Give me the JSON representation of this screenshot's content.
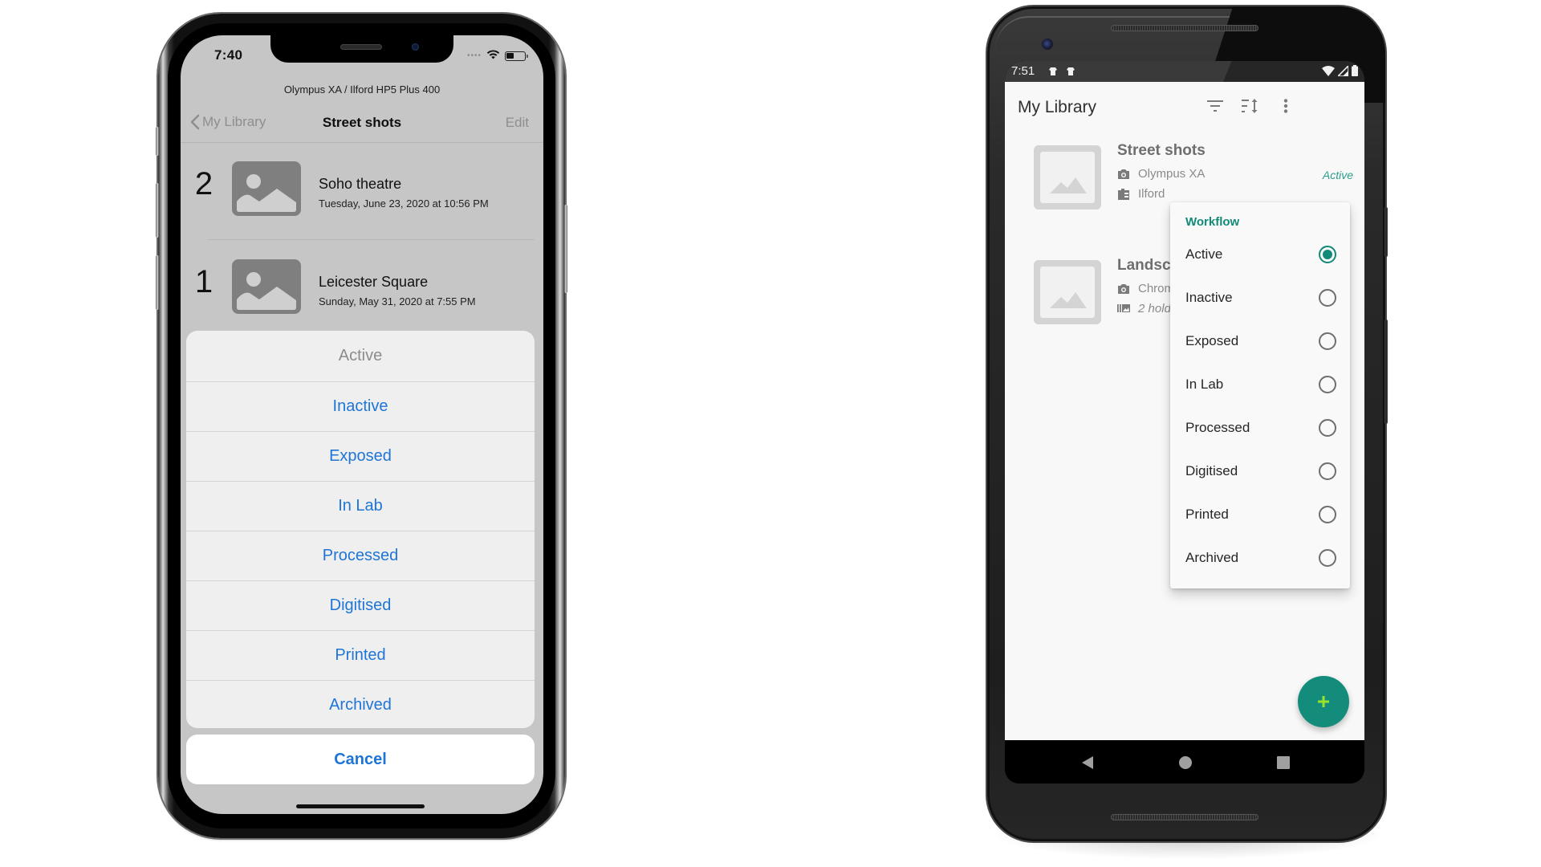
{
  "ios": {
    "status_time": "7:40",
    "subtitle": "Olympus XA / Ilford HP5 Plus 400",
    "nav": {
      "back_label": "My Library",
      "title": "Street shots",
      "edit_label": "Edit"
    },
    "rows": [
      {
        "number": "2",
        "title": "Soho theatre",
        "date": "Tuesday, June 23, 2020 at 10:56 PM"
      },
      {
        "number": "1",
        "title": "Leicester Square",
        "date": "Sunday, May 31, 2020 at 7:55 PM"
      }
    ],
    "action_sheet": {
      "current": "Active",
      "items": [
        "Active",
        "Inactive",
        "Exposed",
        "In Lab",
        "Processed",
        "Digitised",
        "Printed",
        "Archived"
      ],
      "cancel_label": "Cancel"
    }
  },
  "android": {
    "status_time": "7:51",
    "app_title": "My Library",
    "toolbar_icons": [
      "filter-icon",
      "sort-icon",
      "more-vert-icon"
    ],
    "items": [
      {
        "title": "Street shots",
        "camera": "Olympus XA",
        "film": "Ilford",
        "status": "Active"
      },
      {
        "title": "Landscapes",
        "camera": "Chrom",
        "holders": "2 hold"
      }
    ],
    "menu": {
      "header": "Workflow",
      "selected": "Active",
      "options": [
        "Active",
        "Inactive",
        "Exposed",
        "In Lab",
        "Processed",
        "Digitised",
        "Printed",
        "Archived"
      ]
    },
    "fab_icon": "plus-icon",
    "colors": {
      "accent": "#128a78",
      "fab": "#138c7c",
      "fab_plus": "#9be22d",
      "ios_tint": "#1e75d6"
    }
  }
}
